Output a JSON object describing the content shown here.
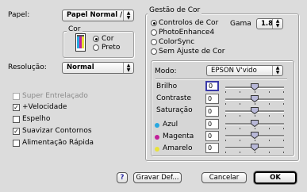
{
  "left": {
    "paper_label": "Papel:",
    "paper_value": "Papel Normal / P...",
    "color_group_title": "Cor",
    "color_options": [
      "Cor",
      "Preto"
    ],
    "resolution_label": "Resolução:",
    "resolution_value": "Normal",
    "checkboxes": [
      {
        "label": "Super Entrelaçado",
        "checked": false,
        "enabled": false
      },
      {
        "label": "+Velocidade",
        "checked": true,
        "enabled": true
      },
      {
        "label": "Espelho",
        "checked": false,
        "enabled": true
      },
      {
        "label": "Suavizar Contornos",
        "checked": true,
        "enabled": true
      },
      {
        "label": "Alimentação Rápida",
        "checked": false,
        "enabled": true
      }
    ]
  },
  "color_mgmt": {
    "title": "Gestão de Cor",
    "options": [
      "Controlos de Cor",
      "PhotoEnhance4",
      "ColorSync",
      "Sem Ajuste de Cor"
    ],
    "selected_index": 0,
    "gamma_label": "Gama",
    "gamma_value": "1.8",
    "mode_label": "Modo:",
    "mode_value": "EPSON V'vido",
    "sliders": [
      {
        "label": "Brilho",
        "value": "0",
        "level": 0.5,
        "bullet": ""
      },
      {
        "label": "Contraste",
        "value": "0",
        "level": 0.5,
        "bullet": ""
      },
      {
        "label": "Saturação",
        "value": "0",
        "level": 0.5,
        "bullet": ""
      },
      {
        "label": "Azul",
        "value": "0",
        "level": 0.5,
        "bullet": "#29a8e0"
      },
      {
        "label": "Magenta",
        "value": "0",
        "level": 0.5,
        "bullet": "#c21f9a"
      },
      {
        "label": "Amarelo",
        "value": "0",
        "level": 0.5,
        "bullet": "#e8e23a"
      }
    ]
  },
  "buttons": {
    "help": "?",
    "save": "Gravar Def...",
    "cancel": "Cancelar",
    "ok": "OK"
  },
  "icons": {
    "ink": "ink-cartridge-icon",
    "thumb": "slider-thumb-icon"
  }
}
